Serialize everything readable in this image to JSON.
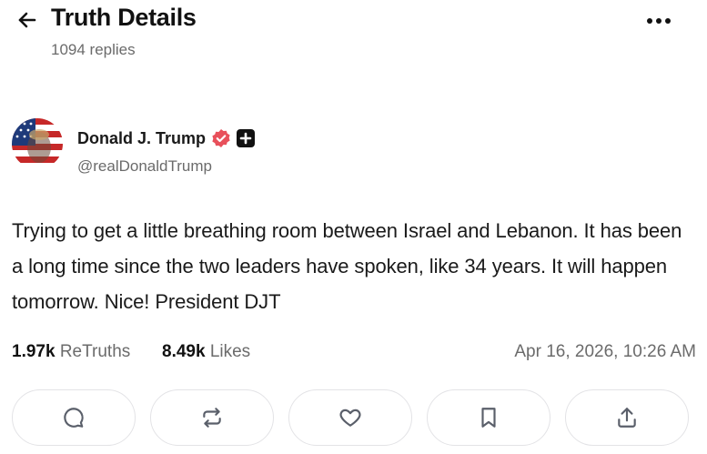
{
  "header": {
    "title": "Truth Details",
    "replies": "1094 replies",
    "back_icon": "arrow-left-icon",
    "more_icon": "more-horizontal-icon"
  },
  "author": {
    "name": "Donald J. Trump",
    "handle": "@realDonaldTrump",
    "verified_color": "#e8505b"
  },
  "post": {
    "text": "Trying to get a little breathing room between Israel and Lebanon. It has been a long time since the two leaders have spoken, like 34 years. It will happen tomorrow. Nice! President DJT"
  },
  "stats": {
    "retruths_count": "1.97k",
    "retruths_label": "ReTruths",
    "likes_count": "8.49k",
    "likes_label": "Likes",
    "timestamp": "Apr 16, 2026, 10:26 AM"
  },
  "actions": {
    "reply_icon": "reply-icon",
    "retruth_icon": "retruth-icon",
    "like_icon": "heart-icon",
    "bookmark_icon": "bookmark-icon",
    "share_icon": "share-icon"
  }
}
